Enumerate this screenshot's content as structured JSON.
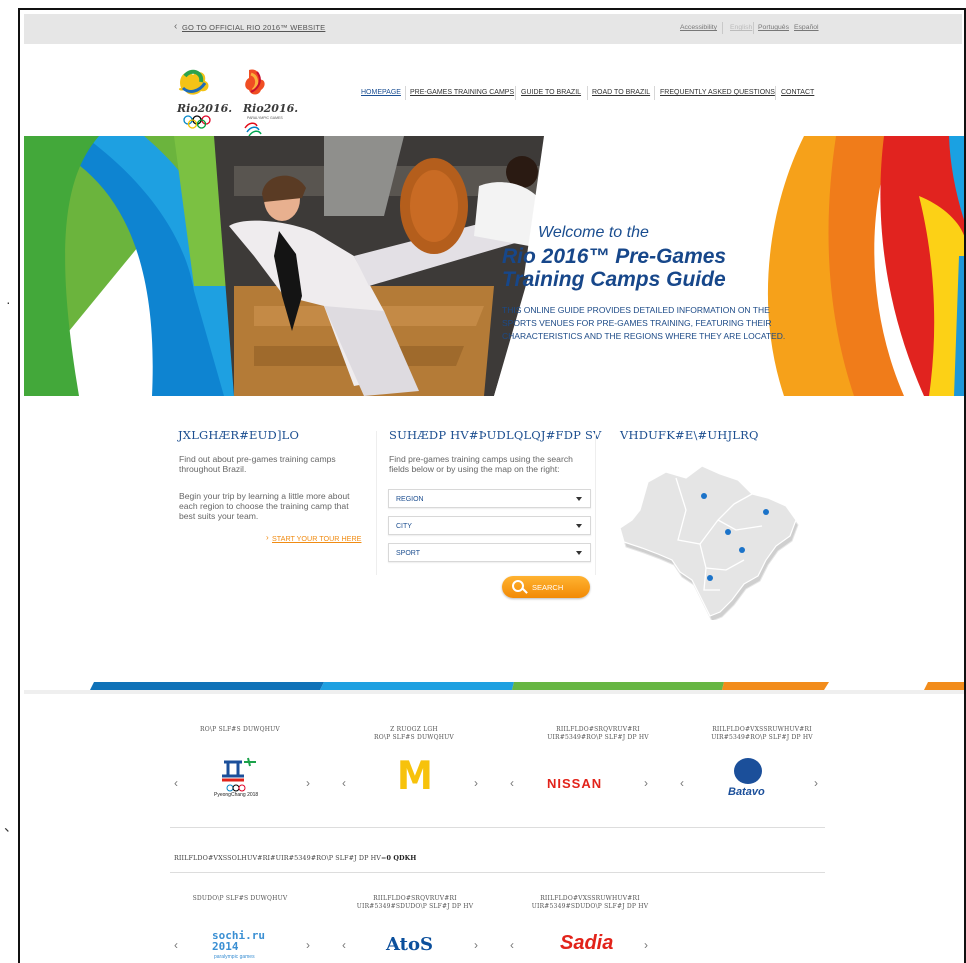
{
  "topbar": {
    "back_link": "GO TO OFFICIAL RIO 2016™ WEBSITE",
    "accessibility": "Accessibility",
    "languages": [
      "English",
      "Português",
      "Español"
    ]
  },
  "logos": {
    "olympic": "Rio2016.",
    "paralympic": "Rio2016.",
    "paralympic_sub": "PARALYMPIC GAMES"
  },
  "nav": [
    "HOMEPAGE",
    "PRE-GAMES TRAINING CAMPS",
    "GUIDE TO BRAZIL",
    "ROAD TO BRAZIL",
    "FREQUENTLY ASKED QUESTIONS",
    "CONTACT"
  ],
  "hero": {
    "welcome": "Welcome to the",
    "title_line1": "Rio 2016™ Pre-Games",
    "title_line2": "Training Camps Guide",
    "description": "THIS ONLINE GUIDE PROVIDES DETAILED INFORMATION ON THE SPORTS VENUES FOR PRE-GAMES TRAINING, FEATURING THEIR CHARACTERISTICS AND THE REGIONS WHERE THEY ARE LOCATED."
  },
  "columns": {
    "guide_heading": "JXLGHÆR#EUD]LO",
    "guide_text1": "Find out about pre-games training camps throughout Brazil.",
    "guide_text2": "Begin your trip by learning a little more about each region to choose the training camp that best suits your team.",
    "start_tour": "START YOUR TOUR HERE",
    "search_heading": "SUHÆDP HV#ÞUDLQLQJ#FDP SV",
    "search_text": "Find pre-games training camps using the search fields below or by using the map on the right:",
    "fields": [
      "REGION",
      "CITY",
      "SPORT"
    ],
    "search_button": "SEARCH",
    "map_heading": "VHDUFK#E\\#UHJLRQ"
  },
  "sponsors_row1": [
    {
      "heading": "RO\\P SLF#S DUWQHUV",
      "brand": "PyeongChang 2018"
    },
    {
      "heading": "Z RUOGZ LGH\nRO\\P SLF#S DUWQHUV",
      "brand": "M"
    },
    {
      "heading": "RIILFLDO#SRQVRUV#RI\nUIR#5349#RO\\P SLF#J DP HV",
      "brand": "NISSAN"
    },
    {
      "heading": "RIILFLDO#VXSSRUWHUV#RI\nUIR#5349#RO\\P SLF#J DP HV",
      "brand": "Batavo"
    }
  ],
  "sponsors_label": "RIILFLDO#VXSSOLHUV#RI#UIR#5349#RO\\P SLF#J DP HV=",
  "sponsors_label_bold": "0 QDKH",
  "sponsors_row2": [
    {
      "heading": "SDUDO\\P SLF#S DUWQHUV",
      "brand": "sochi.ru 2014",
      "sub": "paralympic games"
    },
    {
      "heading": "RIILFLDO#SRQVRUV#RI\nUIR#5349#SDUDO\\P SLF#J DP HV",
      "brand": "AtoS"
    },
    {
      "heading": "RIILFLDO#VXSSRUWHUV#RI\nUIR#5349#SDUDO\\P SLF#J DP HV",
      "brand": "Sadia"
    }
  ],
  "colors": {
    "brand_blue": "#1d4f90",
    "orange": "#f28a05",
    "green": "#72b42d",
    "red": "#e20a17"
  }
}
